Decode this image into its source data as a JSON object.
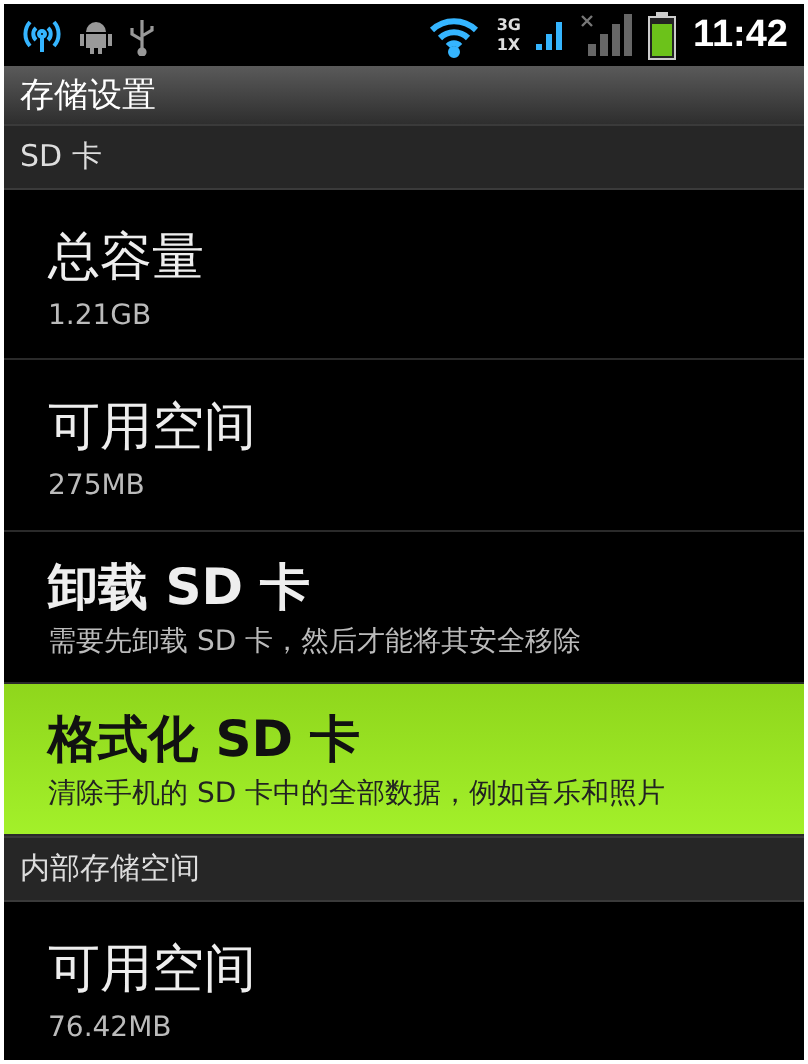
{
  "status_bar": {
    "network_3g": "3G",
    "network_1x": "1X",
    "time": "11:42"
  },
  "title": "存储设置",
  "sections": [
    {
      "header": "SD 卡",
      "items": [
        {
          "kind": "stat",
          "title": "总容量",
          "summary": "1.21GB",
          "selected": false
        },
        {
          "kind": "stat",
          "title": "可用空间",
          "summary": "275MB",
          "selected": false
        },
        {
          "kind": "action",
          "title": "卸载 SD 卡",
          "summary": "需要先卸载 SD 卡，然后才能将其安全移除",
          "selected": false
        },
        {
          "kind": "action",
          "title": "格式化 SD 卡",
          "summary": "清除手机的 SD 卡中的全部数据，例如音乐和照片",
          "selected": true
        }
      ]
    },
    {
      "header": "内部存储空间",
      "items": [
        {
          "kind": "stat",
          "title": "可用空间",
          "summary": "76.42MB",
          "selected": false
        }
      ]
    }
  ]
}
